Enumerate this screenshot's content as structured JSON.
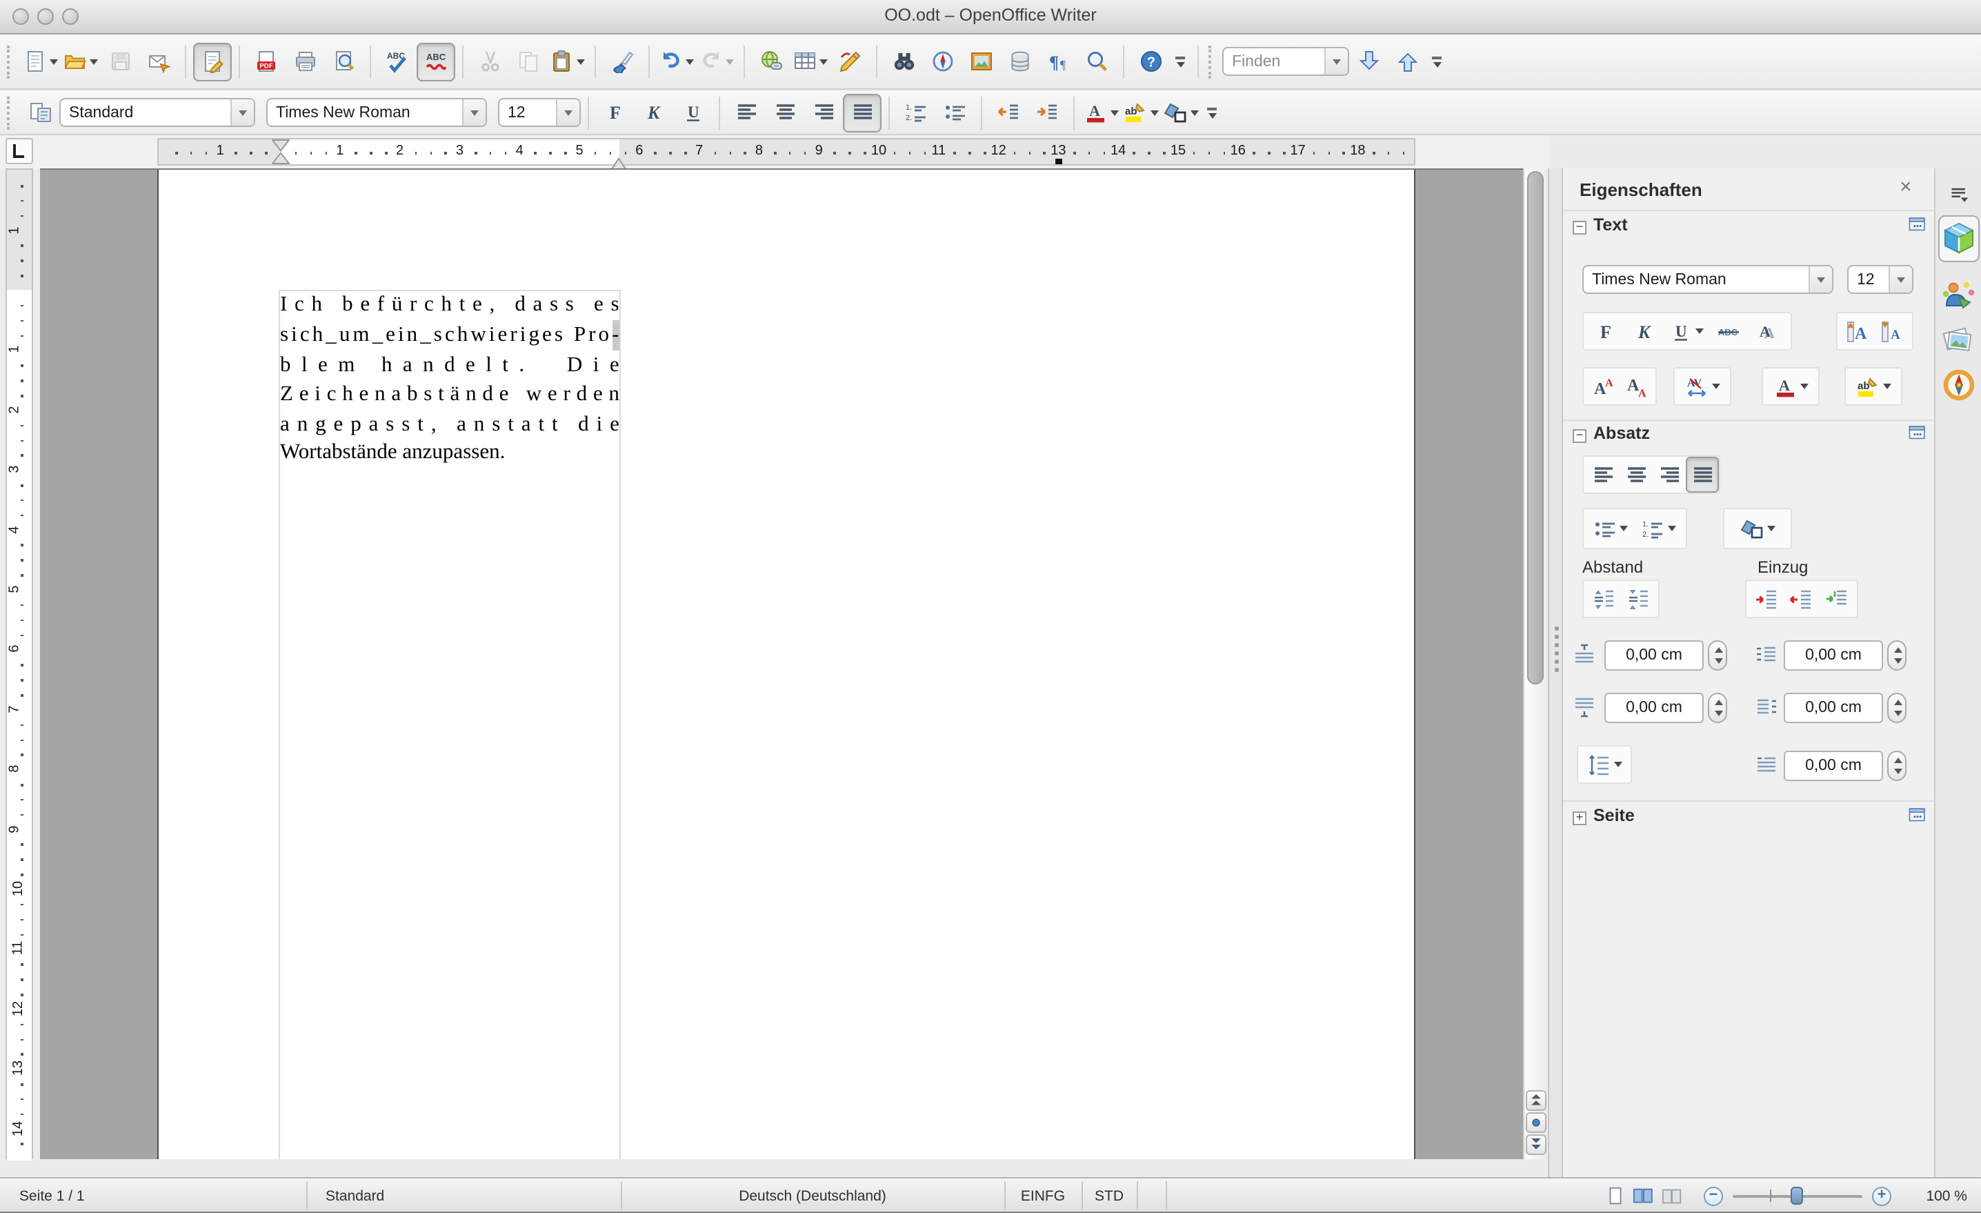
{
  "window": {
    "title": "OO.odt – OpenOffice Writer"
  },
  "toolbar_main": {
    "items": [
      {
        "icon": "new-document",
        "dropdown": true
      },
      {
        "icon": "open",
        "dropdown": true
      },
      {
        "icon": "save",
        "disabled": true
      },
      {
        "icon": "send-email"
      },
      {
        "sep": true
      },
      {
        "icon": "edit-file",
        "pressed": true
      },
      {
        "sep": true
      },
      {
        "icon": "export-pdf"
      },
      {
        "icon": "print"
      },
      {
        "icon": "page-preview"
      },
      {
        "sep": true
      },
      {
        "icon": "spelling"
      },
      {
        "icon": "auto-spellcheck",
        "pressed": true
      },
      {
        "sep": true
      },
      {
        "icon": "cut",
        "disabled": true
      },
      {
        "icon": "copy",
        "disabled": true
      },
      {
        "icon": "paste",
        "dropdown": true
      },
      {
        "sep": true
      },
      {
        "icon": "clone-formatting"
      },
      {
        "sep": true
      },
      {
        "icon": "undo",
        "dropdown": true
      },
      {
        "icon": "redo",
        "disabled": true,
        "dropdown": true
      },
      {
        "sep": true
      },
      {
        "icon": "hyperlink"
      },
      {
        "icon": "table",
        "dropdown": true
      },
      {
        "icon": "draw-functions"
      },
      {
        "sep": true
      },
      {
        "icon": "find-replace"
      },
      {
        "icon": "navigator"
      },
      {
        "icon": "gallery"
      },
      {
        "icon": "data-sources"
      },
      {
        "icon": "formatting-marks"
      },
      {
        "icon": "zoom"
      },
      {
        "sep": true
      },
      {
        "icon": "help"
      }
    ],
    "find_label": "Finden"
  },
  "toolbar_format": {
    "paragraph_style": "Standard",
    "font_name": "Times New Roman",
    "font_size": "12",
    "items": [
      "bold",
      "italic",
      "underline",
      "align-left",
      "align-center",
      "align-right",
      "align-justify",
      "ordered-list",
      "unordered-list",
      "decrease-indent",
      "increase-indent",
      "font-color",
      "highlight-color",
      "background-color"
    ]
  },
  "ruler": {
    "horizontal": {
      "margin_number": "1",
      "numbers": [
        1,
        2,
        3,
        4,
        5,
        6,
        7,
        8,
        9,
        10,
        11,
        12,
        13,
        14,
        15,
        16,
        17,
        18
      ]
    },
    "vertical": {
      "margin_number": "1",
      "numbers": [
        1,
        2,
        3,
        4,
        5,
        6,
        7,
        8,
        9,
        10,
        11,
        12,
        13,
        14
      ]
    }
  },
  "document": {
    "lines": [
      {
        "text": "Ich befürchte, dass es",
        "justified": true
      },
      {
        "text": "sich_um_ein_schwieriges Pro-",
        "justified": true,
        "shade_end": true
      },
      {
        "text": "blem handelt.  Die",
        "justified": true
      },
      {
        "text": "Zeichenabstände werden",
        "justified": true
      },
      {
        "text": "angepasst, anstatt die",
        "justified": true
      },
      {
        "text": "Wortabstände anzupassen.",
        "justified": false
      }
    ]
  },
  "sidebar": {
    "title": "Eigenschaften",
    "text_section": {
      "title": "Text",
      "font_name": "Times New Roman",
      "font_size": "12"
    },
    "paragraph_section": {
      "title": "Absatz",
      "spacing_label": "Abstand",
      "indent_label": "Einzug",
      "spacing_above": "0,00 cm",
      "spacing_below": "0,00 cm",
      "indent_before": "0,00 cm",
      "indent_after": "0,00 cm",
      "indent_firstline": "0,00 cm"
    },
    "page_section": {
      "title": "Seite"
    }
  },
  "statusbar": {
    "page": "Seite 1 / 1",
    "style": "Standard",
    "language": "Deutsch (Deutschland)",
    "insert_mode": "EINFG",
    "selection_mode": "STD",
    "zoom_level": "100 %"
  }
}
